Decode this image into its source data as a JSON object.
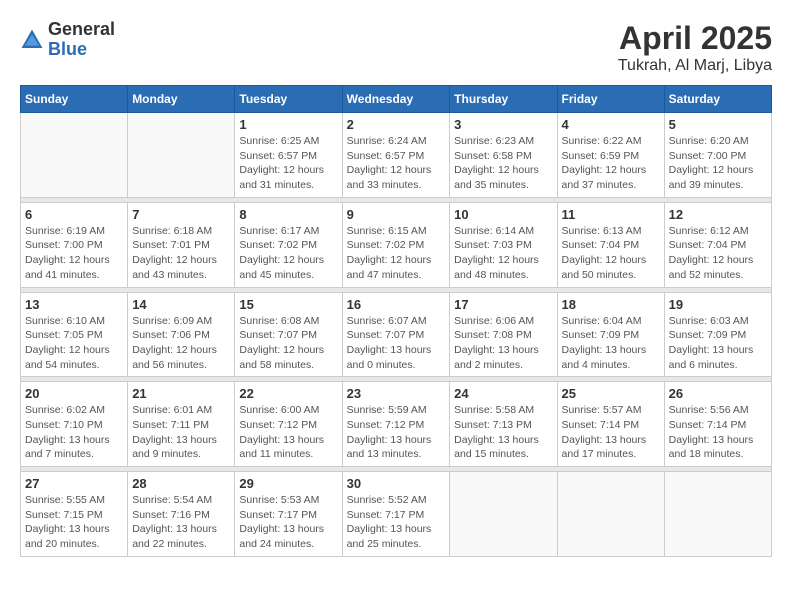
{
  "logo": {
    "general": "General",
    "blue": "Blue"
  },
  "title": {
    "month_year": "April 2025",
    "location": "Tukrah, Al Marj, Libya"
  },
  "weekdays": [
    "Sunday",
    "Monday",
    "Tuesday",
    "Wednesday",
    "Thursday",
    "Friday",
    "Saturday"
  ],
  "weeks": [
    [
      {
        "day": "",
        "info": ""
      },
      {
        "day": "",
        "info": ""
      },
      {
        "day": "1",
        "info": "Sunrise: 6:25 AM\nSunset: 6:57 PM\nDaylight: 12 hours\nand 31 minutes."
      },
      {
        "day": "2",
        "info": "Sunrise: 6:24 AM\nSunset: 6:57 PM\nDaylight: 12 hours\nand 33 minutes."
      },
      {
        "day": "3",
        "info": "Sunrise: 6:23 AM\nSunset: 6:58 PM\nDaylight: 12 hours\nand 35 minutes."
      },
      {
        "day": "4",
        "info": "Sunrise: 6:22 AM\nSunset: 6:59 PM\nDaylight: 12 hours\nand 37 minutes."
      },
      {
        "day": "5",
        "info": "Sunrise: 6:20 AM\nSunset: 7:00 PM\nDaylight: 12 hours\nand 39 minutes."
      }
    ],
    [
      {
        "day": "6",
        "info": "Sunrise: 6:19 AM\nSunset: 7:00 PM\nDaylight: 12 hours\nand 41 minutes."
      },
      {
        "day": "7",
        "info": "Sunrise: 6:18 AM\nSunset: 7:01 PM\nDaylight: 12 hours\nand 43 minutes."
      },
      {
        "day": "8",
        "info": "Sunrise: 6:17 AM\nSunset: 7:02 PM\nDaylight: 12 hours\nand 45 minutes."
      },
      {
        "day": "9",
        "info": "Sunrise: 6:15 AM\nSunset: 7:02 PM\nDaylight: 12 hours\nand 47 minutes."
      },
      {
        "day": "10",
        "info": "Sunrise: 6:14 AM\nSunset: 7:03 PM\nDaylight: 12 hours\nand 48 minutes."
      },
      {
        "day": "11",
        "info": "Sunrise: 6:13 AM\nSunset: 7:04 PM\nDaylight: 12 hours\nand 50 minutes."
      },
      {
        "day": "12",
        "info": "Sunrise: 6:12 AM\nSunset: 7:04 PM\nDaylight: 12 hours\nand 52 minutes."
      }
    ],
    [
      {
        "day": "13",
        "info": "Sunrise: 6:10 AM\nSunset: 7:05 PM\nDaylight: 12 hours\nand 54 minutes."
      },
      {
        "day": "14",
        "info": "Sunrise: 6:09 AM\nSunset: 7:06 PM\nDaylight: 12 hours\nand 56 minutes."
      },
      {
        "day": "15",
        "info": "Sunrise: 6:08 AM\nSunset: 7:07 PM\nDaylight: 12 hours\nand 58 minutes."
      },
      {
        "day": "16",
        "info": "Sunrise: 6:07 AM\nSunset: 7:07 PM\nDaylight: 13 hours\nand 0 minutes."
      },
      {
        "day": "17",
        "info": "Sunrise: 6:06 AM\nSunset: 7:08 PM\nDaylight: 13 hours\nand 2 minutes."
      },
      {
        "day": "18",
        "info": "Sunrise: 6:04 AM\nSunset: 7:09 PM\nDaylight: 13 hours\nand 4 minutes."
      },
      {
        "day": "19",
        "info": "Sunrise: 6:03 AM\nSunset: 7:09 PM\nDaylight: 13 hours\nand 6 minutes."
      }
    ],
    [
      {
        "day": "20",
        "info": "Sunrise: 6:02 AM\nSunset: 7:10 PM\nDaylight: 13 hours\nand 7 minutes."
      },
      {
        "day": "21",
        "info": "Sunrise: 6:01 AM\nSunset: 7:11 PM\nDaylight: 13 hours\nand 9 minutes."
      },
      {
        "day": "22",
        "info": "Sunrise: 6:00 AM\nSunset: 7:12 PM\nDaylight: 13 hours\nand 11 minutes."
      },
      {
        "day": "23",
        "info": "Sunrise: 5:59 AM\nSunset: 7:12 PM\nDaylight: 13 hours\nand 13 minutes."
      },
      {
        "day": "24",
        "info": "Sunrise: 5:58 AM\nSunset: 7:13 PM\nDaylight: 13 hours\nand 15 minutes."
      },
      {
        "day": "25",
        "info": "Sunrise: 5:57 AM\nSunset: 7:14 PM\nDaylight: 13 hours\nand 17 minutes."
      },
      {
        "day": "26",
        "info": "Sunrise: 5:56 AM\nSunset: 7:14 PM\nDaylight: 13 hours\nand 18 minutes."
      }
    ],
    [
      {
        "day": "27",
        "info": "Sunrise: 5:55 AM\nSunset: 7:15 PM\nDaylight: 13 hours\nand 20 minutes."
      },
      {
        "day": "28",
        "info": "Sunrise: 5:54 AM\nSunset: 7:16 PM\nDaylight: 13 hours\nand 22 minutes."
      },
      {
        "day": "29",
        "info": "Sunrise: 5:53 AM\nSunset: 7:17 PM\nDaylight: 13 hours\nand 24 minutes."
      },
      {
        "day": "30",
        "info": "Sunrise: 5:52 AM\nSunset: 7:17 PM\nDaylight: 13 hours\nand 25 minutes."
      },
      {
        "day": "",
        "info": ""
      },
      {
        "day": "",
        "info": ""
      },
      {
        "day": "",
        "info": ""
      }
    ]
  ]
}
